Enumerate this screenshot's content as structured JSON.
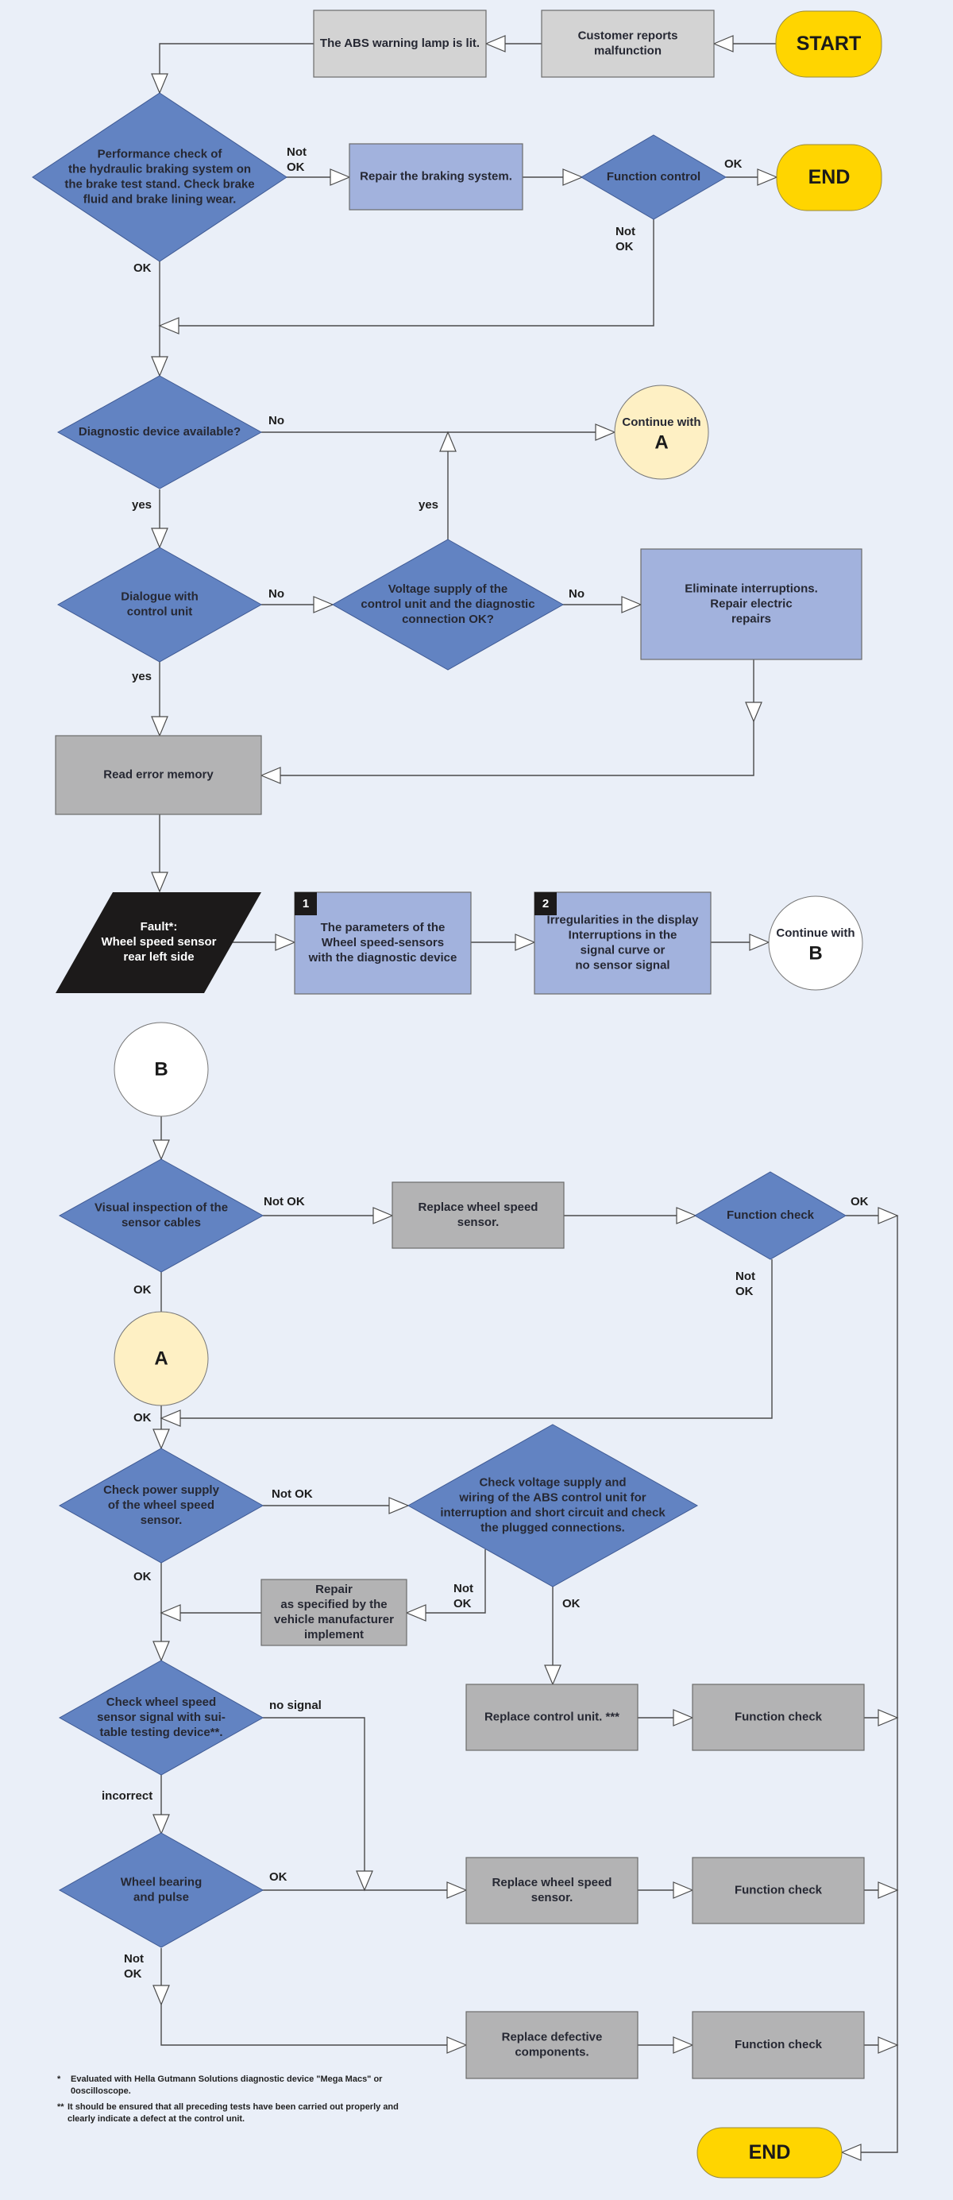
{
  "colors": {
    "background": "#eaeff8",
    "terminal": "#ffd500",
    "decision": "#6283c2",
    "process_light_blue": "#a2b2dd",
    "process_light_gray": "#d3d3d3",
    "process_gray": "#b3b3b4",
    "connector_a": "#fef0c4",
    "connector_b": "#ffffff",
    "fault": "#1c1a1a"
  },
  "part1": {
    "start": "START",
    "customer_reports": [
      "Customer reports",
      "malfunction"
    ],
    "abs_lamp": [
      "The ABS warning lamp is lit."
    ],
    "performance_check": [
      "Performance check of",
      "the hydraulic braking system on",
      "the brake test stand. Check brake",
      "fluid and brake lining wear."
    ],
    "repair_braking": [
      "Repair the braking system."
    ],
    "function_control": [
      "Function control"
    ],
    "end_top": "END",
    "diagnostic_available": [
      "Diagnostic device available?"
    ],
    "continue_a": {
      "line1": "Continue with",
      "letter": "A"
    },
    "dialogue": [
      "Dialogue with",
      "control unit"
    ],
    "voltage_supply": [
      "Voltage supply of the",
      "control unit and the diagnostic",
      "connection OK?"
    ],
    "eliminate": [
      "Eliminate interruptions.",
      "Repair electric",
      "repairs"
    ],
    "read_error": [
      "Read error memory"
    ],
    "fault": [
      "Fault*:",
      "Wheel speed sensor",
      "rear left side"
    ],
    "step1": {
      "badge": "1",
      "text": [
        "The parameters of the",
        "Wheel speed-sensors",
        "with the diagnostic device"
      ]
    },
    "step2": {
      "badge": "2",
      "text": [
        "Irregularities in the display",
        "Interruptions in the",
        "signal curve or",
        "no sensor signal"
      ]
    },
    "continue_b": {
      "line1": "Continue with",
      "letter": "B"
    },
    "labels": {
      "perf_not_ok": [
        "Not",
        "OK"
      ],
      "perf_ok": "OK",
      "func_ok": "OK",
      "func_not_ok": [
        "Not",
        "OK"
      ],
      "diag_no": "No",
      "diag_yes": "yes",
      "volt_yes": "yes",
      "dialogue_no": "No",
      "volt_no": "No",
      "dialogue_yes": "yes"
    }
  },
  "part2": {
    "connector_b": "B",
    "visual_inspection": [
      "Visual inspection of the",
      "sensor cables"
    ],
    "replace_sensor_1": [
      "Replace wheel speed",
      "sensor."
    ],
    "function_check_diamond": [
      "Function check"
    ],
    "connector_a": "A",
    "check_power": [
      "Check power supply",
      "of the wheel speed",
      "sensor."
    ],
    "check_voltage_abs": [
      "Check voltage supply and",
      "wiring of the ABS control unit for",
      "interruption and short circuit and check",
      "the plugged connections."
    ],
    "repair_manufacturer": [
      "Repair",
      "as specified by the",
      "vehicle manufacturer",
      "implement"
    ],
    "check_signal": [
      "Check wheel speed",
      "sensor signal with sui-",
      "table testing device**."
    ],
    "replace_control_unit": [
      "Replace control unit. ***"
    ],
    "function_check_1": [
      "Function check"
    ],
    "wheel_bearing": [
      "Wheel bearing",
      "and pulse"
    ],
    "replace_sensor_2": [
      "Replace wheel speed",
      "sensor."
    ],
    "function_check_2": [
      "Function check"
    ],
    "replace_defective": [
      "Replace defective",
      "components."
    ],
    "function_check_3": [
      "Function check"
    ],
    "end_bottom": "END",
    "labels": {
      "visual_not_ok": "Not OK",
      "visual_ok": "OK",
      "fc_ok": "OK",
      "fc_not_ok": [
        "Not",
        "OK"
      ],
      "a_ok": "OK",
      "power_not_ok": "Not OK",
      "power_ok": "OK",
      "abs_not_ok": [
        "Not",
        "OK"
      ],
      "abs_ok": "OK",
      "signal_no_signal": "no signal",
      "signal_incorrect": "incorrect",
      "bearing_ok": "OK",
      "bearing_not_ok": [
        "Not",
        "OK"
      ]
    }
  },
  "footnotes": [
    [
      "*",
      "Evaluated with Hella Gutmann Solutions diagnostic device \"Mega Macs\" or",
      "0oscilloscope."
    ],
    [
      "**",
      "It should be ensured that all preceding tests have been carried out properly and",
      "clearly indicate a defect at the control unit."
    ]
  ]
}
